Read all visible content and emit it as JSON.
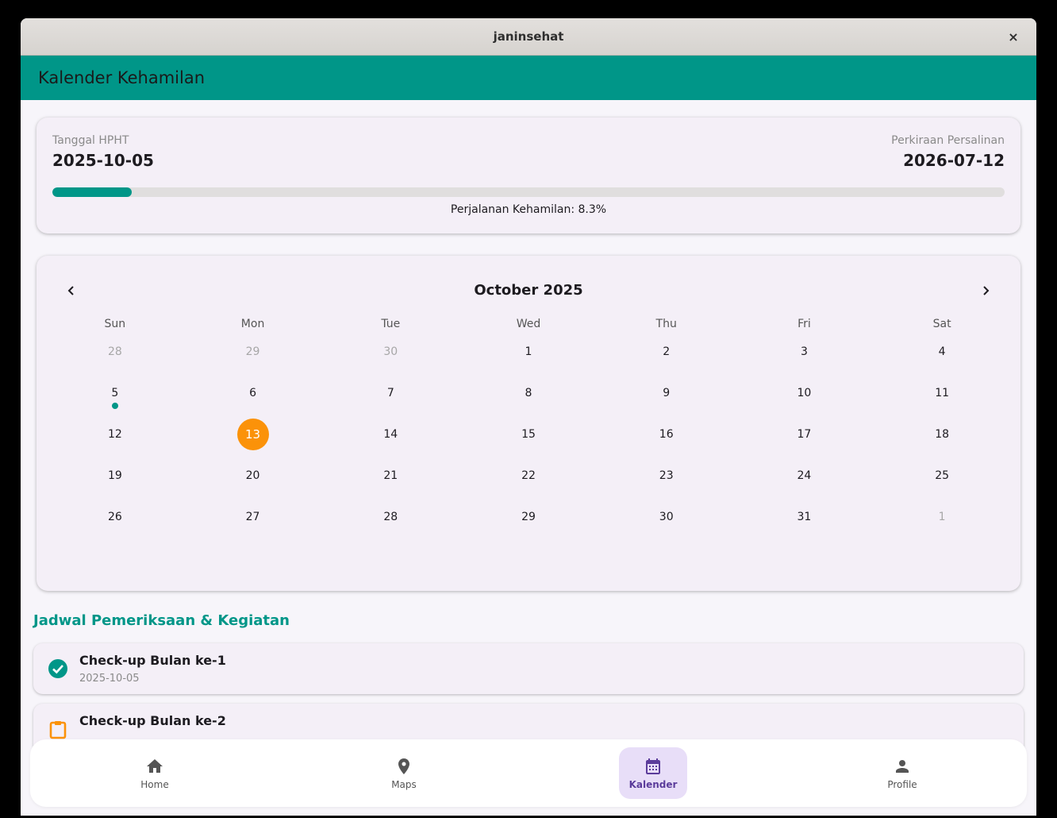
{
  "window": {
    "title": "janinsehat",
    "close_label": "×"
  },
  "appbar": {
    "glyph": "",
    "title": "Kalender Kehamilan"
  },
  "info": {
    "hpht_label": " Tanggal HPHT",
    "hpht_value": "2025-10-05",
    "due_label": " Perkiraan Persalinan",
    "due_value": "2026-07-12",
    "progress_percent": 8.3,
    "journey_text": " Perjalanan Kehamilan: 8.3%",
    "colors": {
      "accent": "#009688",
      "track": "#e0dede"
    }
  },
  "calendar": {
    "month_label": "October 2025",
    "prev_icon": "chevron-left-icon",
    "next_icon": "chevron-right-icon",
    "weekdays": [
      "Sun",
      "Mon",
      "Tue",
      "Wed",
      "Thu",
      "Fri",
      "Sat"
    ],
    "days": [
      {
        "n": "28",
        "muted": true
      },
      {
        "n": "29",
        "muted": true
      },
      {
        "n": "30",
        "muted": true
      },
      {
        "n": "1"
      },
      {
        "n": "2"
      },
      {
        "n": "3"
      },
      {
        "n": "4"
      },
      {
        "n": "5",
        "marker": true
      },
      {
        "n": "6"
      },
      {
        "n": "7"
      },
      {
        "n": "8"
      },
      {
        "n": "9"
      },
      {
        "n": "10"
      },
      {
        "n": "11"
      },
      {
        "n": "12"
      },
      {
        "n": "13",
        "selected": true
      },
      {
        "n": "14"
      },
      {
        "n": "15"
      },
      {
        "n": "16"
      },
      {
        "n": "17"
      },
      {
        "n": "18"
      },
      {
        "n": "19"
      },
      {
        "n": "20"
      },
      {
        "n": "21"
      },
      {
        "n": "22"
      },
      {
        "n": "23"
      },
      {
        "n": "24"
      },
      {
        "n": "25"
      },
      {
        "n": "26"
      },
      {
        "n": "27"
      },
      {
        "n": "28"
      },
      {
        "n": "29"
      },
      {
        "n": "30"
      },
      {
        "n": "31"
      },
      {
        "n": "1",
        "muted": true
      }
    ],
    "colors": {
      "selected": "#fb9209",
      "marker": "#009688"
    }
  },
  "schedule": {
    "title": " Jadwal Pemeriksaan & Kegiatan",
    "items": [
      {
        "title": "Check-up Bulan ke-1",
        "date": "2025-10-05",
        "icon": "check-circle-icon",
        "icon_color": "#009688"
      },
      {
        "title": "Check-up Bulan ke-2",
        "date": "",
        "icon": "clipboard-icon",
        "icon_color": "#fb9209"
      }
    ]
  },
  "bottom_nav": {
    "items": [
      {
        "label": "Home",
        "icon": "home-icon"
      },
      {
        "label": "Maps",
        "icon": "location-pin-icon"
      },
      {
        "label": "Kalender",
        "icon": "calendar-icon",
        "active": true
      },
      {
        "label": "Profile",
        "icon": "person-icon"
      }
    ]
  }
}
